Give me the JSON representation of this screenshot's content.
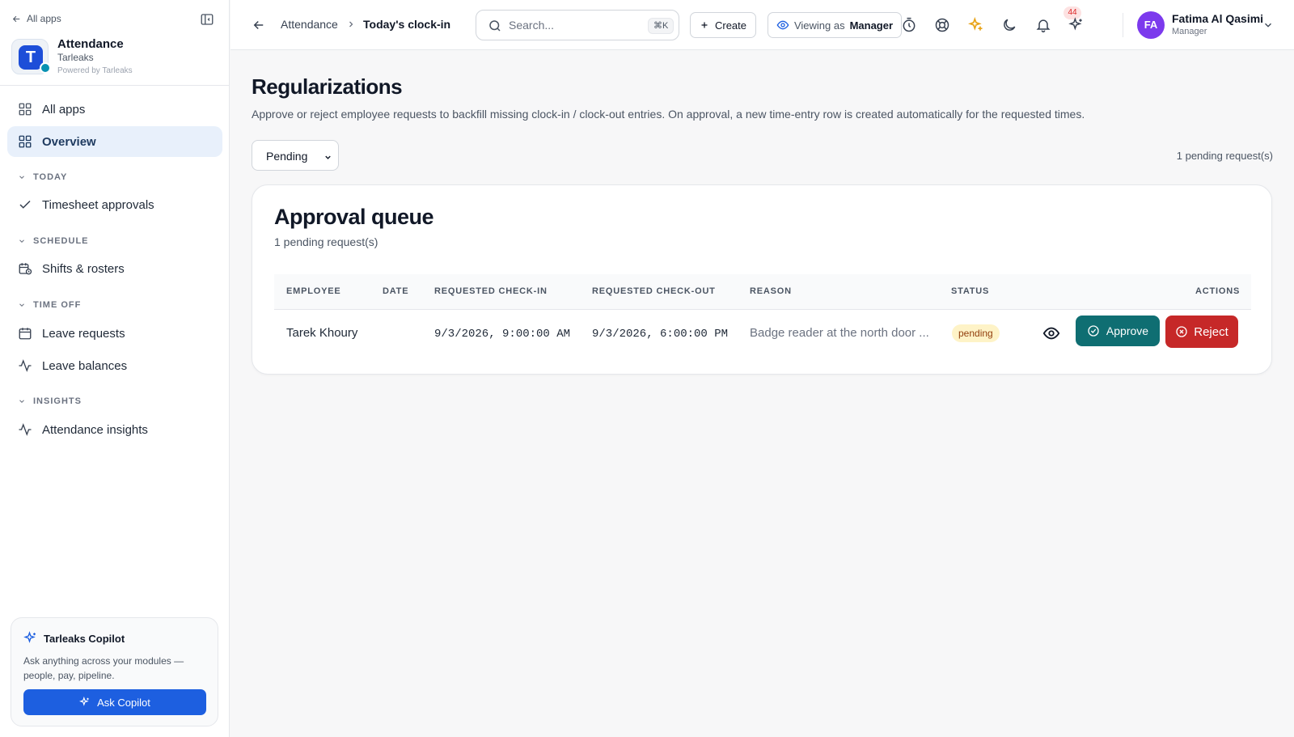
{
  "sidebar": {
    "all_apps_link": "All apps",
    "app": {
      "logo_letter": "T",
      "name": "Attendance",
      "org": "Tarleaks",
      "powered": "Powered by Tarleaks"
    },
    "items": [
      {
        "label": "All apps",
        "icon": "grid-icon"
      },
      {
        "label": "Overview",
        "icon": "grid-icon",
        "active": true
      }
    ],
    "sections": [
      {
        "title": "TODAY",
        "items": [
          {
            "label": "Timesheet approvals",
            "icon": "check-icon"
          }
        ]
      },
      {
        "title": "SCHEDULE",
        "items": [
          {
            "label": "Shifts & rosters",
            "icon": "calendar-clock-icon"
          }
        ]
      },
      {
        "title": "TIME OFF",
        "items": [
          {
            "label": "Leave requests",
            "icon": "calendar-icon"
          },
          {
            "label": "Leave balances",
            "icon": "activity-icon"
          }
        ]
      },
      {
        "title": "INSIGHTS",
        "items": [
          {
            "label": "Attendance insights",
            "icon": "activity-icon"
          }
        ]
      }
    ],
    "copilot": {
      "title": "Tarleaks Copilot",
      "description": "Ask anything across your modules — people, pay, pipeline.",
      "button": "Ask Copilot"
    }
  },
  "topbar": {
    "breadcrumb": [
      "Attendance",
      "Today's clock-in"
    ],
    "search_placeholder": "Search...",
    "search_shortcut": "⌘K",
    "create_label": "Create",
    "viewing_as_prefix": "Viewing as",
    "viewing_as_role": "Manager",
    "notification_count": "44",
    "user": {
      "initials": "FA",
      "name": "Fatima Al Qasimi",
      "role": "Manager"
    }
  },
  "main": {
    "title": "Regularizations",
    "description": "Approve or reject employee requests to backfill missing clock-in / clock-out entries. On approval, a new time-entry row is created automatically for the requested times.",
    "filter": {
      "selected": "Pending"
    },
    "pending_count": "1 pending request(s)",
    "queue": {
      "title": "Approval queue",
      "subtitle": "1 pending request(s)",
      "columns": [
        "EMPLOYEE",
        "DATE",
        "REQUESTED CHECK-IN",
        "REQUESTED CHECK-OUT",
        "REASON",
        "STATUS",
        "ACTIONS"
      ],
      "rows": [
        {
          "employee": "Tarek Khoury",
          "date": "",
          "check_in": "9/3/2026, 9:00:00 AM",
          "check_out": "9/3/2026, 6:00:00 PM",
          "reason": "Badge reader at the north door ...",
          "status": "pending",
          "approve_label": "Approve",
          "reject_label": "Reject"
        }
      ]
    }
  },
  "colors": {
    "primary": "#1d5fe0",
    "approve": "#0f6e72",
    "reject": "#c62828",
    "active_nav": "#e8f0fb",
    "avatar": "#7c3aed"
  }
}
